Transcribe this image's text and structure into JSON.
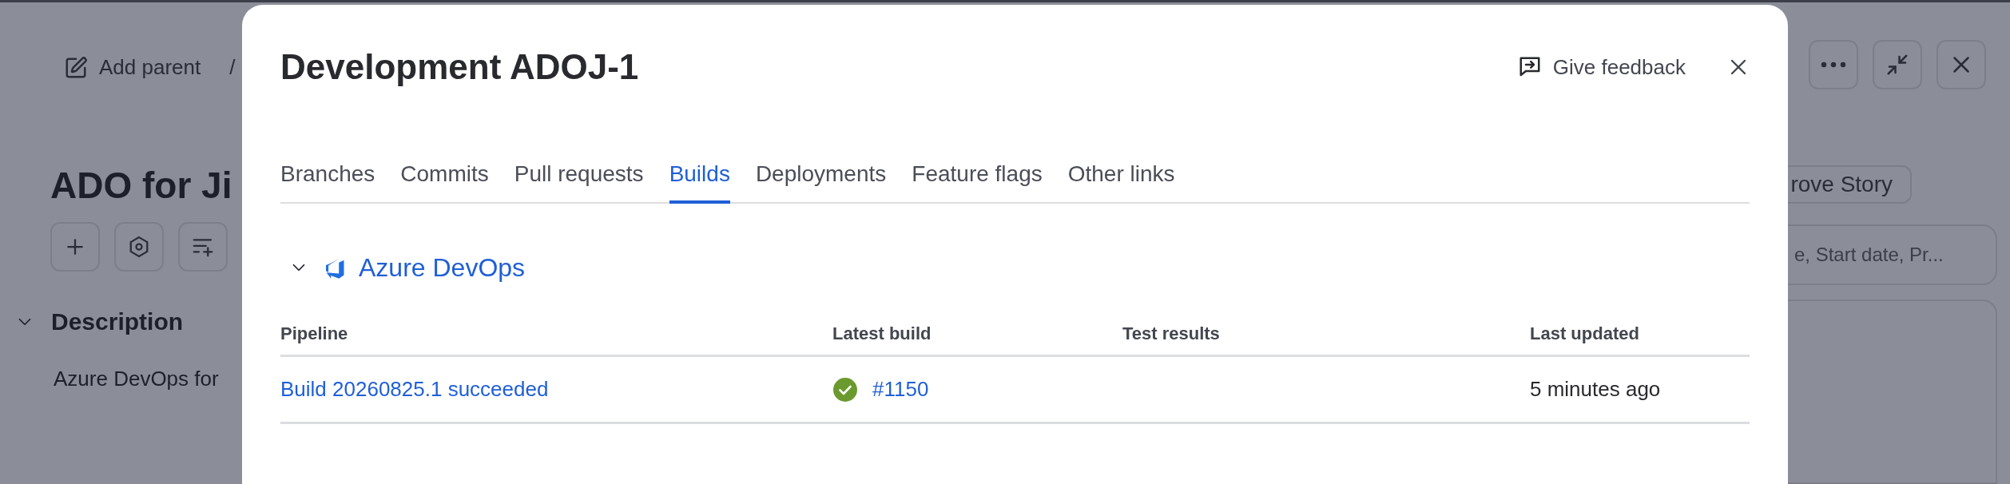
{
  "background": {
    "breadcrumb": {
      "add_parent": "Add parent",
      "separator": "/"
    },
    "title": "ADO for Ji",
    "section": {
      "title": "Description",
      "expanded": true,
      "text": "Azure DevOps for"
    },
    "action_button": "rove Story",
    "fields_summary": "e, Start date, Pr..."
  },
  "modal": {
    "title": "Development ADOJ-1",
    "feedback": "Give feedback",
    "tabs": [
      {
        "label": "Branches",
        "selected": false
      },
      {
        "label": "Commits",
        "selected": false
      },
      {
        "label": "Pull requests",
        "selected": false
      },
      {
        "label": "Builds",
        "selected": true
      },
      {
        "label": "Deployments",
        "selected": false
      },
      {
        "label": "Feature flags",
        "selected": false
      },
      {
        "label": "Other links",
        "selected": false
      }
    ],
    "provider": {
      "name": "Azure DevOps",
      "expanded": true
    },
    "table": {
      "columns": [
        "Pipeline",
        "Latest build",
        "Test results",
        "Last updated"
      ],
      "rows": [
        {
          "pipeline": "Build 20260825.1 succeeded",
          "kind": "success",
          "build": "#1150",
          "last_updated": "5 minutes ago"
        }
      ]
    }
  }
}
